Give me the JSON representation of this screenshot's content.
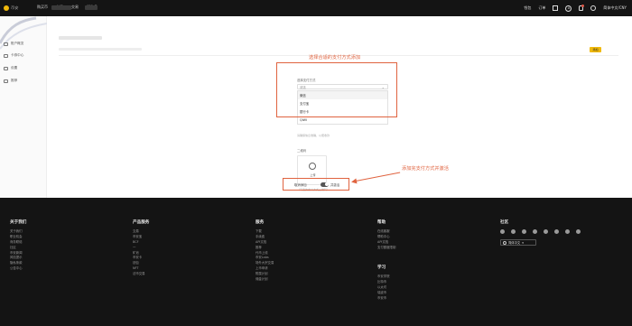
{
  "nav": {
    "logo_text": "币安",
    "links": [
      "购买币",
      "市场",
      "交易",
      "衍生品"
    ],
    "right": {
      "orders_label": "钱包",
      "wallet_label": "订单",
      "lang_label": "简体中文/CNY"
    }
  },
  "sidebar": {
    "items": [
      {
        "label": "账户概览"
      },
      {
        "label": "卡券中心"
      },
      {
        "label": "设置"
      },
      {
        "label": "推荐"
      }
    ]
  },
  "main": {
    "action_button": "添加",
    "form": {
      "select_label": "选择支付方式",
      "select_placeholder": "请选",
      "options": [
        "微信",
        "支付宝",
        "银行卡",
        "QIWI"
      ],
      "hint": "请确保信息准确，以便收款",
      "qr_label": "二维码",
      "qr_upload": "上传",
      "qr_hint": "（可选的支付方式二维码）",
      "cancel_label": "取消添加",
      "save_label": "并激活"
    }
  },
  "annotations": {
    "top_note": "选择合适的支付方式添加",
    "bottom_note": "添加完支付方式并激活"
  },
  "footer": {
    "columns": [
      {
        "title": "关于我们",
        "items": [
          "关于我们",
          "职业机会",
          "商务联络",
          "社区",
          "币安新闻",
          "风险提示",
          "隐私条款",
          "公告中心"
        ]
      },
      {
        "title": "产品服务",
        "items": [
          "交易",
          "币安宝",
          "BCF",
          "一",
          "矿池",
          "币安卡",
          "钱包",
          "NFT",
          "法币交易"
        ]
      },
      {
        "title": "服务",
        "items": [
          "下载",
          "手续费",
          "API文档",
          "推荐",
          "代币上线",
          "币安Labs",
          "场外大宗交易",
          "上币申请",
          "附属计划",
          "佣金计划"
        ]
      },
      {
        "title": "帮助",
        "items": [
          "在线客服",
          "帮助中心",
          "API文档",
          "支付额度限制"
        ]
      },
      {
        "title": "学习",
        "items": [
          "币安学院",
          "比特币",
          "以太坊",
          "瑞波币",
          "币安币"
        ]
      },
      {
        "title": "社区",
        "items": []
      }
    ],
    "lang_label": "简体中文"
  },
  "colors": {
    "accent": "#f0b90b",
    "annotation": "#e0633f",
    "nav_bg": "#141414"
  }
}
